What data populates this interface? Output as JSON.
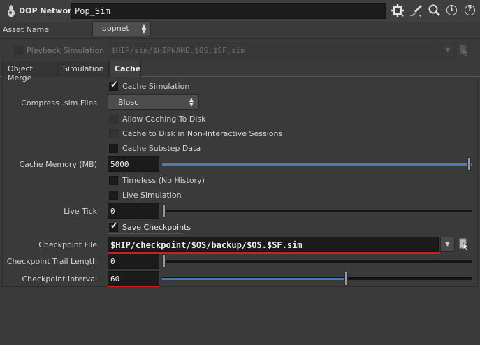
{
  "header": {
    "network_label": "DOP Network",
    "node_name": "Pop_Sim",
    "icons": [
      "dop-network-icon",
      "gear-icon",
      "brush-icon",
      "magnifier-icon",
      "info-icon",
      "help-icon"
    ],
    "help_glyph": "?",
    "info_glyph": "i"
  },
  "asset": {
    "label": "Asset Name",
    "value": "dopnet"
  },
  "playback": {
    "label": "Playback Simulation",
    "path": "$HIP/sim/$HIPNAME.$OS.$SF.sim",
    "checked": false,
    "enabled": false
  },
  "tabs": [
    {
      "label": "Object Merge",
      "selected": false
    },
    {
      "label": "Simulation",
      "selected": false
    },
    {
      "label": "Cache",
      "selected": true
    }
  ],
  "cache": {
    "cache_simulation": {
      "label": "Cache Simulation",
      "checked": true
    },
    "compress": {
      "label": "Compress .sim Files",
      "value": "Blosc"
    },
    "allow_caching_to_disk": {
      "label": "Allow Caching To Disk",
      "checked": false,
      "enabled": false
    },
    "cache_to_disk_noninteractive": {
      "label": "Cache to Disk in Non-Interactive Sessions",
      "checked": false,
      "enabled": false
    },
    "cache_substep_data": {
      "label": "Cache Substep Data",
      "checked": false
    },
    "cache_memory": {
      "label": "Cache Memory (MB)",
      "value": "5000",
      "slider_fraction": 1.0
    },
    "timeless": {
      "label": "Timeless (No History)",
      "checked": false
    },
    "live_simulation": {
      "label": "Live Simulation",
      "checked": false
    },
    "live_tick": {
      "label": "Live Tick",
      "value": "0",
      "slider_fraction": 0.0
    },
    "save_checkpoints": {
      "label": "Save Checkpoints",
      "checked": true
    },
    "checkpoint_file": {
      "label": "Checkpoint File",
      "value": "$HIP/checkpoint/$OS/backup/$OS.$SF.sim"
    },
    "checkpoint_trail_length": {
      "label": "Checkpoint Trail Length",
      "value": "0",
      "slider_fraction": 0.0
    },
    "checkpoint_interval": {
      "label": "Checkpoint Interval",
      "value": "60",
      "slider_fraction": 0.595
    }
  },
  "colors": {
    "background": "#3a3a3a",
    "field": "#1b1b1b",
    "slider_fill": "#4a7ab0",
    "highlight_underline": "#d21d1d"
  }
}
